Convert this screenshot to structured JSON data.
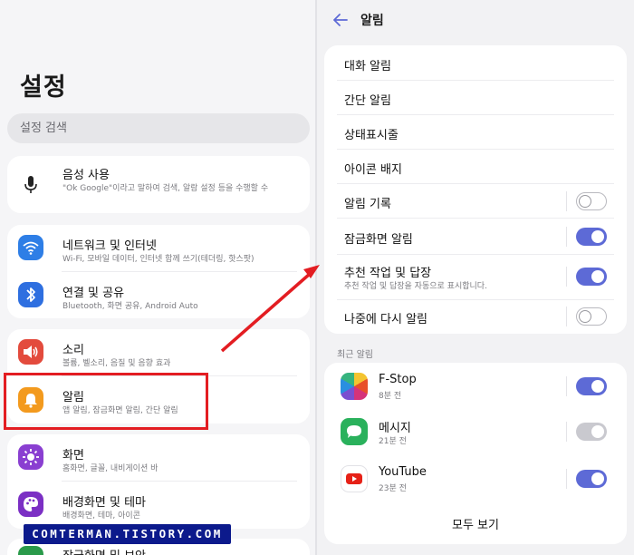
{
  "left": {
    "title": "설정",
    "search_placeholder": "설정 검색",
    "items": [
      {
        "title": "음성 사용",
        "sub": "\"Ok Google\"이라고 말하여 검색, 알람 설정 등을 수행할 수",
        "icon": "mic-icon"
      },
      {
        "title": "네트워크 및 인터넷",
        "sub": "Wi-Fi, 모바일 데이터, 인터넷 함께 쓰기(테더링, 핫스팟)",
        "icon": "wifi-icon"
      },
      {
        "title": "연결 및 공유",
        "sub": "Bluetooth, 화면 공유, Android Auto",
        "icon": "bluetooth-icon"
      },
      {
        "title": "소리",
        "sub": "볼륨, 벨소리, 음질 및 음향 효과",
        "icon": "speaker-icon"
      },
      {
        "title": "알림",
        "sub": "앱 알림, 잠금화면 알림, 간단 알림",
        "icon": "bell-icon"
      },
      {
        "title": "화면",
        "sub": "홈화면, 글꼴, 내비게이션 바",
        "icon": "brightness-icon"
      },
      {
        "title": "배경화면 및 테마",
        "sub": "배경화면, 테마, 아이콘",
        "icon": "palette-icon"
      },
      {
        "title": "잠금화면 및 보안",
        "sub": "",
        "icon": "lock-icon"
      }
    ],
    "watermark": "COMTERMAN.TISTORY.COM"
  },
  "right": {
    "title": "알림",
    "rows": [
      {
        "label": "대화 알림"
      },
      {
        "label": "간단 알림"
      },
      {
        "label": "상태표시줄"
      },
      {
        "label": "아이콘 배지"
      },
      {
        "label": "알림 기록",
        "toggle": "off"
      },
      {
        "label": "잠금화면 알림",
        "toggle": "on"
      },
      {
        "label": "추천 작업 및 답장",
        "sub": "추천 작업 및 답장을 자동으로 표시합니다.",
        "toggle": "on"
      },
      {
        "label": "나중에 다시 알림",
        "toggle": "off"
      }
    ],
    "recent_label": "최근 알림",
    "apps": [
      {
        "name": "F-Stop",
        "time": "8분 전",
        "toggle": "on"
      },
      {
        "name": "메시지",
        "time": "21분 전",
        "toggle": "dim"
      },
      {
        "name": "YouTube",
        "time": "23분 전",
        "toggle": "on"
      }
    ],
    "see_all": "모두 보기"
  },
  "colors": {
    "accent": "#5d6ad6",
    "highlight": "#e31d22",
    "watermark_bg": "#0c1a8c"
  }
}
